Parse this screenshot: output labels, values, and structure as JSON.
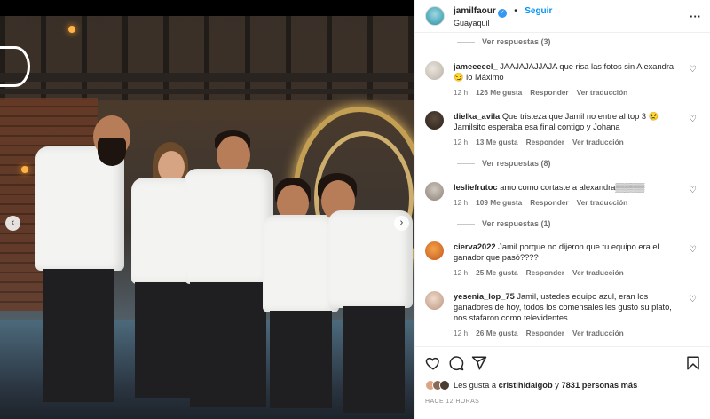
{
  "header": {
    "username": "jamilfaour",
    "separator": "•",
    "follow_label": "Seguir",
    "location": "Guayaquil",
    "more_icon": "more-options-icon"
  },
  "comments": {
    "top_view_replies": "Ver respuestas (3)",
    "items": [
      {
        "username": "jameeeeel_",
        "text": "JAAJAJAJJAJA que risa las fotos sin Alexandra 😏 lo Máximo",
        "time": "12 h",
        "likes": "126 Me gusta",
        "reply": "Responder",
        "translate": "Ver traducción"
      },
      {
        "username": "dielka_avila",
        "text": "Que tristeza que Jamil no entre al top 3 😢 Jamilsito esperaba esa final contigo y Johana",
        "time": "12 h",
        "likes": "13 Me gusta",
        "reply": "Responder",
        "translate": "Ver traducción",
        "view_replies": "Ver respuestas (8)"
      },
      {
        "username": "lesliefrutoc",
        "text": "amo como cortaste a alexandra▒▒▒▒▒",
        "time": "12 h",
        "likes": "109 Me gusta",
        "reply": "Responder",
        "translate": "Ver traducción",
        "view_replies": "Ver respuestas (1)"
      },
      {
        "username": "cierva2022",
        "text": "Jamil porque no dijeron que tu equipo era el ganador que pasó????",
        "time": "12 h",
        "likes": "25 Me gusta",
        "reply": "Responder",
        "translate": "Ver traducción"
      },
      {
        "username": "yesenia_lop_75",
        "text": "Jamil, ustedes equipo azul, eran los ganadores de hoy, todos los comensales les gusto su plato, nos stafaron como televidentes",
        "time": "12 h",
        "likes": "26 Me gusta",
        "reply": "Responder",
        "translate": "Ver traducción"
      }
    ]
  },
  "footer": {
    "likes_prefix": "Les gusta a",
    "likes_user": "cristihidalgob",
    "likes_mid": "y",
    "likes_count": "7831 personas más",
    "timestamp": "HACE 12 HORAS"
  },
  "colors": {
    "accent": "#0095f6",
    "text": "#262626",
    "muted": "#737373"
  }
}
